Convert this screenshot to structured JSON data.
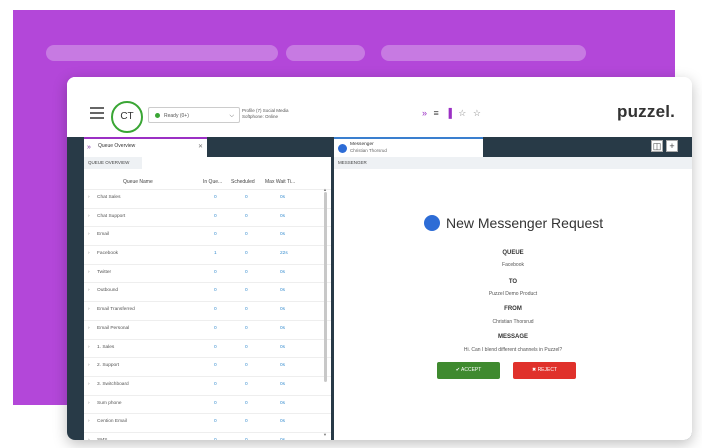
{
  "header": {
    "avatar_initials": "CT",
    "status": "Ready (0+)",
    "profile_line": "Profile (7) Social Media",
    "softphone_line": "Softphone: Online",
    "logo": "puzzel."
  },
  "left_panel": {
    "tab_title": "Queue Overview",
    "section": "QUEUE OVERVIEW",
    "columns": [
      "Queue Name",
      "In Que...",
      "Scheduled",
      "Max Wait Ti..."
    ],
    "rows": [
      {
        "name": "Chat Sales",
        "in_queue": "0",
        "scheduled": "0",
        "max_wait": "0s"
      },
      {
        "name": "Chat Support",
        "in_queue": "0",
        "scheduled": "0",
        "max_wait": "0s"
      },
      {
        "name": "Email",
        "in_queue": "0",
        "scheduled": "0",
        "max_wait": "0s"
      },
      {
        "name": "Facebook",
        "in_queue": "1",
        "scheduled": "0",
        "max_wait": "22s"
      },
      {
        "name": "Twitter",
        "in_queue": "0",
        "scheduled": "0",
        "max_wait": "0s"
      },
      {
        "name": "Outbound",
        "in_queue": "0",
        "scheduled": "0",
        "max_wait": "0s"
      },
      {
        "name": "Email Transferred",
        "in_queue": "0",
        "scheduled": "0",
        "max_wait": "0s"
      },
      {
        "name": "Email Personal",
        "in_queue": "0",
        "scheduled": "0",
        "max_wait": "0s"
      },
      {
        "name": "1. Sales",
        "in_queue": "0",
        "scheduled": "0",
        "max_wait": "0s"
      },
      {
        "name": "2. Support",
        "in_queue": "0",
        "scheduled": "0",
        "max_wait": "0s"
      },
      {
        "name": "3. Switchboard",
        "in_queue": "0",
        "scheduled": "0",
        "max_wait": "0s"
      },
      {
        "name": "Sum phone",
        "in_queue": "0",
        "scheduled": "0",
        "max_wait": "0s"
      },
      {
        "name": "Cention Email",
        "in_queue": "0",
        "scheduled": "0",
        "max_wait": "0s"
      },
      {
        "name": "SMS",
        "in_queue": "0",
        "scheduled": "0",
        "max_wait": "0s"
      }
    ]
  },
  "right_panel": {
    "tab_title": "Messenger",
    "tab_subtitle": "Christian Thorsrud",
    "section": "MESSENGER",
    "request_title": "New Messenger Request",
    "queue_label": "QUEUE",
    "queue_value": "Facebook",
    "to_label": "TO",
    "to_value": "Puzzel Demo Product",
    "from_label": "FROM",
    "from_value": "Christian Thorsrud",
    "message_label": "MESSAGE",
    "message_value": "Hi. Can I blend different channels in Puzzel?",
    "accept_label": "✔ ACCEPT",
    "reject_label": "✖ REJECT"
  }
}
